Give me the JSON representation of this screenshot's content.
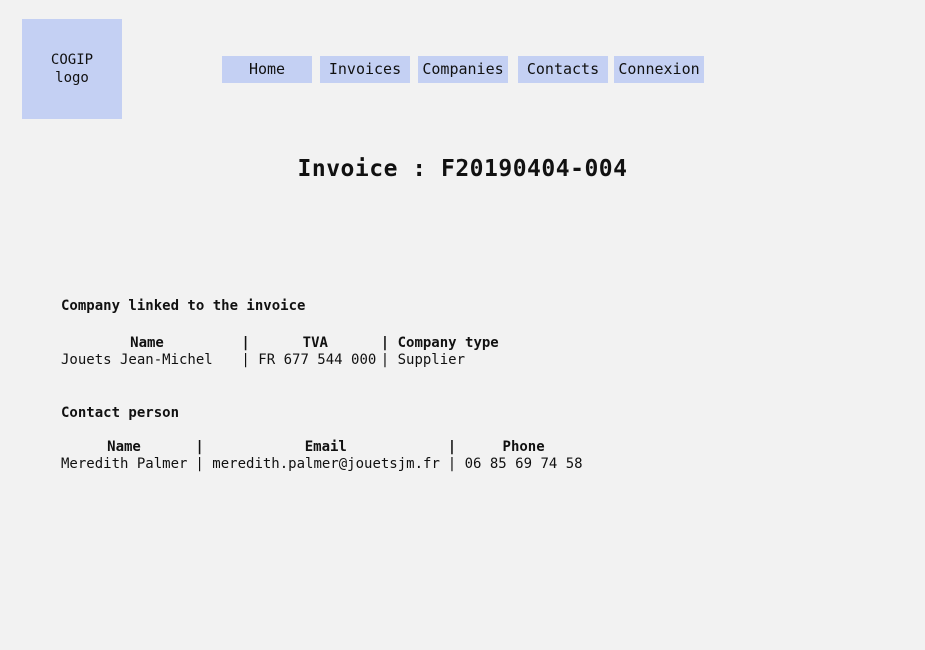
{
  "logo": {
    "text": "COGIP\nlogo"
  },
  "nav": {
    "home": "Home",
    "invoices": "Invoices",
    "companies": "Companies",
    "contacts": "Contacts",
    "connexion": "Connexion"
  },
  "invoice": {
    "title": "Invoice : F20190404-004"
  },
  "company_section": {
    "title": "Company linked to the invoice",
    "headers": {
      "name": "Name",
      "tva": "TVA",
      "type": "Company type"
    },
    "row": {
      "name": "Jouets Jean-Michel",
      "tva": "FR 677 544 000",
      "type": "Supplier"
    }
  },
  "contact_section": {
    "title": "Contact person",
    "headers": {
      "name": "Name",
      "email": "Email",
      "phone": "Phone"
    },
    "row": {
      "name": "Meredith Palmer",
      "email": "meredith.palmer@jouetsjm.fr",
      "phone": "06 85 69 74 58"
    }
  }
}
